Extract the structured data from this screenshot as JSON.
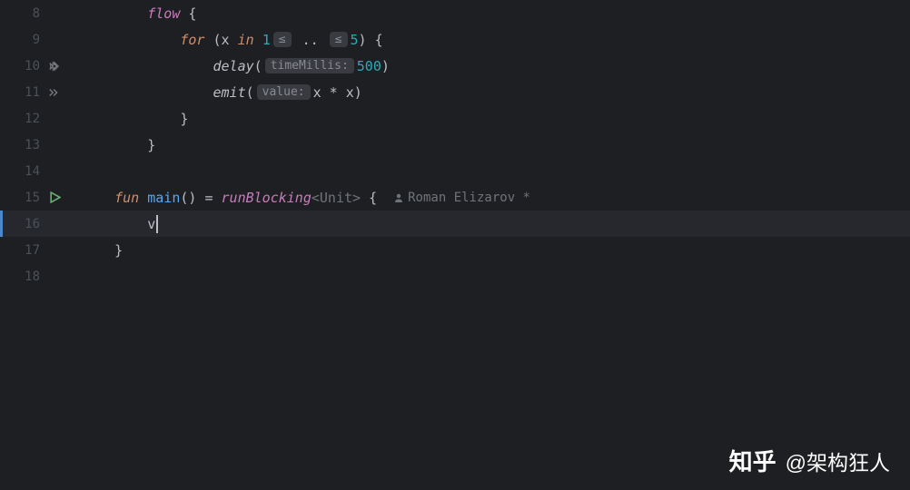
{
  "gutter": {
    "lines": [
      "8",
      "9",
      "10",
      "11",
      "12",
      "13",
      "14",
      "15",
      "16",
      "17",
      "18"
    ]
  },
  "code": {
    "l8": {
      "indent": "        ",
      "fn": "flow",
      "after": " {"
    },
    "l9": {
      "indent": "            ",
      "kw_for": "for",
      "paren_open": " (",
      "var": "x",
      "kw_in": " in ",
      "n1": "1",
      "hint1": "≤",
      "dots": " .. ",
      "hint2": "≤",
      "n2": "5",
      "paren_close": ") {"
    },
    "l10": {
      "indent": "                ",
      "fn": "delay",
      "open": "(",
      "hint_label": "timeMillis:",
      "val": "500",
      "close": ")"
    },
    "l11": {
      "indent": "                ",
      "fn": "emit",
      "open": "(",
      "hint_label": "value:",
      "expr_a": "x",
      "op": " * ",
      "expr_b": "x",
      "close": ")"
    },
    "l12": {
      "indent": "            ",
      "brace": "}"
    },
    "l13": {
      "indent": "        ",
      "brace": "}"
    },
    "l14": {
      "indent": ""
    },
    "l15": {
      "indent": "    ",
      "kw_fun": "fun",
      "sp1": " ",
      "fn_name": "main",
      "parens": "()",
      "eq": " = ",
      "call": "runBlocking",
      "type_arg": "<Unit>",
      "brace": " {",
      "author": "Roman Elizarov *"
    },
    "l16": {
      "indent": "        ",
      "text": "v"
    },
    "l17": {
      "indent": "    ",
      "brace": "}"
    },
    "l18": {
      "indent": ""
    }
  },
  "watermark": {
    "logo": "知乎",
    "at": "@架构狂人"
  }
}
